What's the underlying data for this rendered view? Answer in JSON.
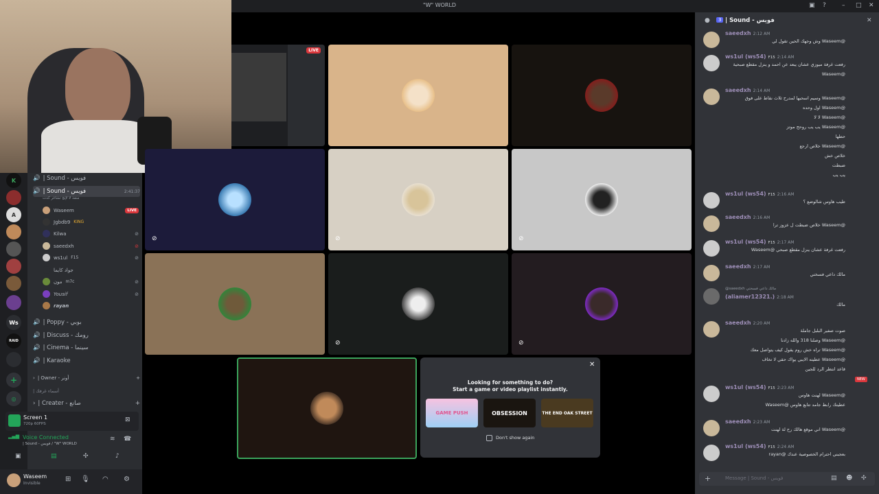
{
  "window": {
    "title": "\"W\" WORLD"
  },
  "stage": {
    "tiles": [
      {
        "live_badge": "LIVE"
      }
    ]
  },
  "sidebar": {
    "channels": [
      {
        "label": "| Sound - فويس",
        "count": "2"
      },
      {
        "label": "| Sound - فويس",
        "count": "3",
        "duration": "2:41:37",
        "status": "منفذ لا لإتج تشاغر كدت"
      },
      {
        "label": "| Poppy - بوبي"
      },
      {
        "label": "| Discuss - رومك"
      },
      {
        "label": "| Cinema - سينما"
      },
      {
        "label": "| Karaoke"
      },
      {
        "label": "| Owner - أونر"
      },
      {
        "label": "| أسماء غرفك"
      },
      {
        "label": "| Creater - صانع"
      }
    ],
    "voice_users": [
      {
        "name": "Waseem",
        "badge": "LIVE"
      },
      {
        "name": "Jgbdb9",
        "badge": "KING"
      },
      {
        "name": "Kilwa"
      },
      {
        "name": "saeedxh"
      },
      {
        "name": "ws1ul",
        "badge": "F15"
      },
      {
        "name": "جواد كايما"
      },
      {
        "name": "مون",
        "badge": "m7c"
      },
      {
        "name": "Yousif"
      },
      {
        "name": "rayan"
      }
    ],
    "screen_share": {
      "title": "Screen 1",
      "sub": "720p 60FPS"
    },
    "voice": {
      "status": "Voice Connected",
      "channel": "| Sound - فويس / \"W\" WORLD"
    },
    "user": {
      "name": "Waseem",
      "status": "Invisible"
    }
  },
  "popup": {
    "title": "Looking for something to do?",
    "subtitle": "Start a game or video playlist instantly.",
    "games": [
      "GAME PUSH",
      "OBSESSION",
      "THE END OAK STREET"
    ],
    "checkbox_label": "Don't show again"
  },
  "chat": {
    "header": "| Sound - فويس",
    "header_count": "3",
    "input_placeholder": "Message | Sound - فويس",
    "new_label": "NEW",
    "messages": [
      {
        "user": "saeedxh",
        "time": "2:12 AM",
        "lines": [
          "@Waseem وش وجهك الحين تقول لي"
        ]
      },
      {
        "user": "ws1ul (ws54)",
        "tag": "F15",
        "time": "2:14 AM",
        "lines": [
          "رفعت غرفة ميوزي عشان يبعد عن احمد و ينزل مقطع صبحية",
          "@Waseem"
        ]
      },
      {
        "user": "saeedxh",
        "time": "2:14 AM",
        "lines": [
          "@Waseem وسيم اسحبها لمدرح ثلاث نقاط على فوق",
          "@Waseem اول وحده",
          "@Waseem لا لا",
          "@Waseem يب يب روحح موتز",
          "حطها",
          "@Waseem خلاص ارجع",
          "خلاص خش",
          "ضبطت",
          "يب يب"
        ]
      },
      {
        "user": "ws1ul (ws54)",
        "tag": "F15",
        "time": "2:16 AM",
        "lines": [
          "طيب هاوس شالوضع ؟"
        ]
      },
      {
        "user": "saeedxh",
        "time": "2:16 AM",
        "lines": [
          "@Waseem خلاص ضبطت ل عزوز ترا"
        ]
      },
      {
        "user": "ws1ul (ws54)",
        "tag": "F15",
        "time": "2:17 AM",
        "lines": [
          "رفعت غرفة عشان ينزل مقطع صبحي @Waseem"
        ]
      },
      {
        "user": "saeedxh",
        "time": "2:17 AM",
        "lines": [
          "مالك داعي فسختي"
        ]
      },
      {
        "user": "(aliamer12321.)",
        "time": "2:18 AM",
        "reply": "@saeedxh مالك داعي فسختي",
        "lines": [
          "مالك"
        ]
      },
      {
        "user": "saeedxh",
        "time": "2:20 AM",
        "lines": [
          "صوت صفير البلبل جاملة",
          "@Waseem وصلنا 318 والله زادنا",
          "@Waseem تراه خش روم يقول كيف يتواصل معك",
          "@Waseem عطيته الايبي يواك حقي لا تخاف",
          "قاعد انتظر الرد للجين"
        ]
      },
      {
        "user": "ws1ul (ws54)",
        "tag": "F15",
        "time": "2:23 AM",
        "lines": [
          "@Waseem لهنت هاوس",
          "عطيتك رابط جامد تتابع هاوس @Waseem"
        ]
      },
      {
        "user": "saeedxh",
        "time": "2:23 AM",
        "lines": [
          "@Waseem اني موقع هالك رح لة لهنت"
        ]
      },
      {
        "user": "ws1ul (ws54)",
        "tag": "F15",
        "time": "2:24 AM",
        "lines": [
          "بعجبني احترام الخصوصية عندك @rayan"
        ]
      }
    ]
  },
  "colors": {
    "accent": "#5865f2",
    "live": "#da373c",
    "connected": "#23a559",
    "tile_highlight": "#3ba55c"
  }
}
